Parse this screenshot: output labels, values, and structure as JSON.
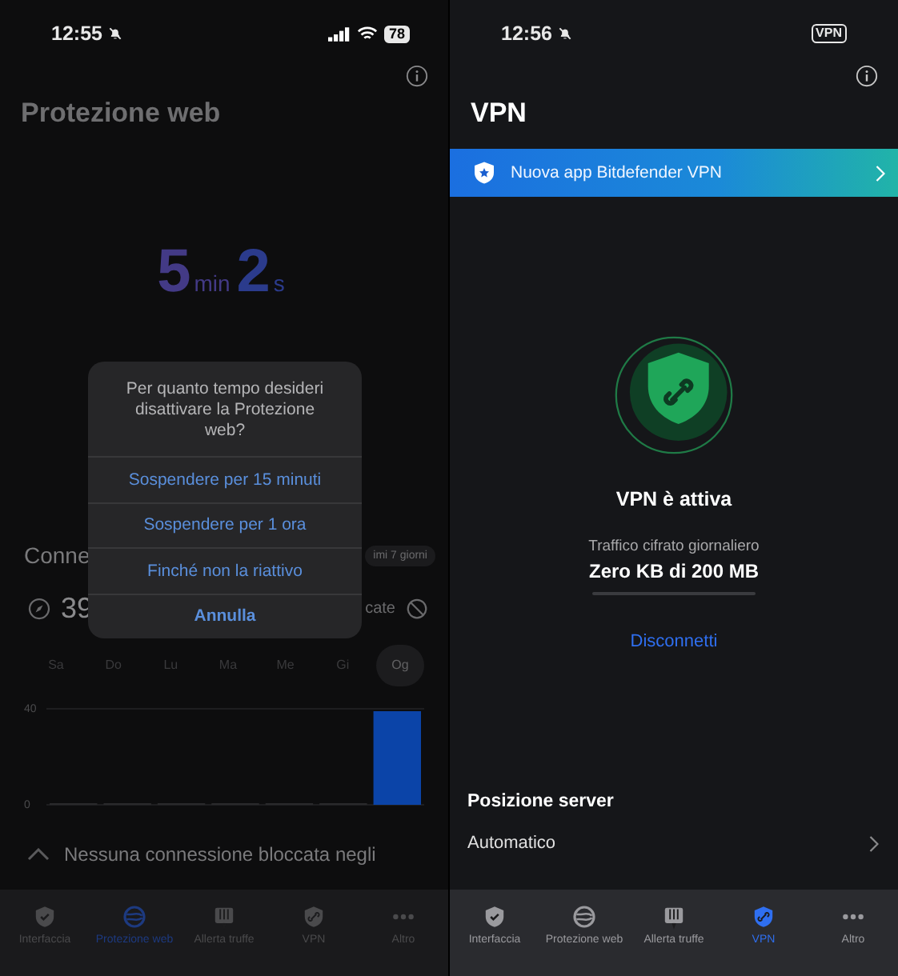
{
  "web_protection_screen": {
    "status_bar": {
      "time": "12:55",
      "battery": "78"
    },
    "title": "Protezione web",
    "timer": {
      "minutes": "5",
      "minutes_unit": "min",
      "seconds": "2",
      "seconds_unit": "s"
    },
    "connections": {
      "heading": "Conne",
      "period": "imi 7 giorni",
      "count": "39",
      "blocked_label": "cate"
    },
    "days": [
      {
        "label": "Sa",
        "selected": false
      },
      {
        "label": "Do",
        "selected": false
      },
      {
        "label": "Lu",
        "selected": false
      },
      {
        "label": "Ma",
        "selected": false
      },
      {
        "label": "Me",
        "selected": false
      },
      {
        "label": "Gi",
        "selected": false
      },
      {
        "label": "Og",
        "selected": true
      }
    ],
    "chart_data": {
      "type": "bar",
      "ylim": [
        0,
        40
      ],
      "yticks": [
        0,
        40
      ],
      "values": [
        0,
        0,
        0,
        0,
        0,
        0,
        39
      ]
    },
    "message": "Nessuna connessione bloccata negli",
    "tabs": [
      {
        "label": "Interfaccia",
        "selected": false
      },
      {
        "label": "Protezione web",
        "selected": true
      },
      {
        "label": "Allerta truffe",
        "selected": false
      },
      {
        "label": "VPN",
        "selected": false
      },
      {
        "label": "Altro",
        "selected": false
      }
    ],
    "dialog": {
      "title": "Per quanto tempo desideri disattivare la Protezione web?",
      "options": [
        {
          "label": "Sospendere per 15 minuti",
          "kind": "option"
        },
        {
          "label": "Sospendere per 1 ora",
          "kind": "option"
        },
        {
          "label": "Finché non la riattivo",
          "kind": "option"
        },
        {
          "label": "Annulla",
          "kind": "cancel"
        }
      ]
    }
  },
  "vpn_screen": {
    "status_bar": {
      "time": "12:56",
      "vpn_badge": "VPN"
    },
    "title": "VPN",
    "banner": {
      "text": "Nuova app Bitdefender VPN"
    },
    "status": {
      "title": "VPN è attiva",
      "traffic_label": "Traffico cifrato giornaliero",
      "traffic_value": "Zero KB di 200 MB",
      "level": 0
    },
    "disconnect": "Disconnetti",
    "server": {
      "heading": "Posizione server",
      "value": "Automatico"
    },
    "tabs": [
      {
        "label": "Interfaccia",
        "selected": false
      },
      {
        "label": "Protezione web",
        "selected": false
      },
      {
        "label": "Allerta truffe",
        "selected": false
      },
      {
        "label": "VPN",
        "selected": true
      },
      {
        "label": "Altro",
        "selected": false
      }
    ]
  }
}
